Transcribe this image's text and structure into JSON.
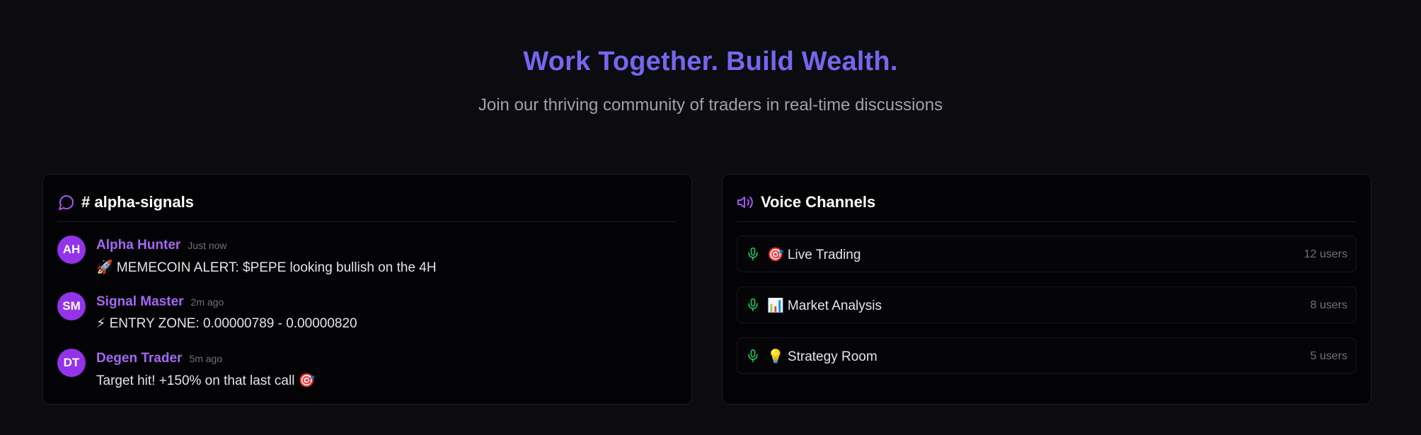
{
  "hero": {
    "title": "Work Together. Build Wealth.",
    "subtitle": "Join our thriving community of traders in real-time discussions"
  },
  "chat": {
    "title": "# alpha-signals",
    "icon": "message-circle-icon",
    "messages": [
      {
        "initials": "AH",
        "author": "Alpha Hunter",
        "time": "Just now",
        "text": "🚀 MEMECOIN ALERT: $PEPE looking bullish on the 4H"
      },
      {
        "initials": "SM",
        "author": "Signal Master",
        "time": "2m ago",
        "text": "⚡ ENTRY ZONE: 0.00000789 - 0.00000820"
      },
      {
        "initials": "DT",
        "author": "Degen Trader",
        "time": "5m ago",
        "text": "Target hit! +150% on that last call 🎯"
      }
    ]
  },
  "voice": {
    "title": "Voice Channels",
    "icon": "speaker-icon",
    "channels": [
      {
        "name": "🎯 Live Trading",
        "count": "12 users"
      },
      {
        "name": "📊 Market Analysis",
        "count": "8 users"
      },
      {
        "name": "💡 Strategy Room",
        "count": "5 users"
      }
    ]
  },
  "colors": {
    "background": "#0b0b10",
    "accent": "#7666ee",
    "author": "#a667f5",
    "avatar": "#9333ea",
    "mic": "#22c55e"
  }
}
